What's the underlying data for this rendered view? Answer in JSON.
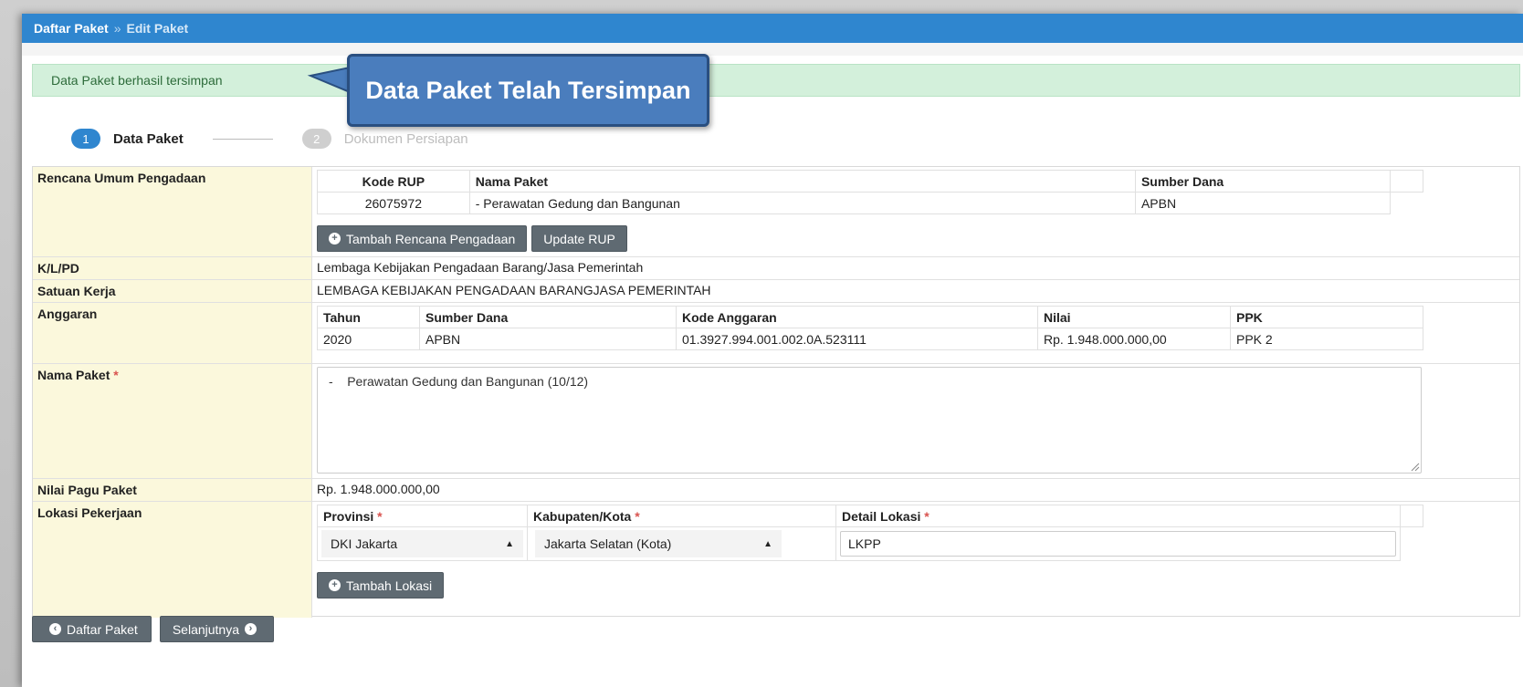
{
  "breadcrumb": {
    "root": "Daftar Paket",
    "sep": "»",
    "current": "Edit Paket"
  },
  "alert": {
    "message": "Data Paket berhasil tersimpan"
  },
  "callout": {
    "text": "Data Paket Telah Tersimpan"
  },
  "steps": [
    {
      "num": "1",
      "label": "Data Paket",
      "active": true
    },
    {
      "num": "2",
      "label": "Dokumen Persiapan",
      "active": false
    }
  ],
  "rup": {
    "label": "Rencana Umum Pengadaan",
    "headers": [
      "Kode RUP",
      "Nama Paket",
      "Sumber Dana"
    ],
    "rows": [
      [
        "26075972",
        "- Perawatan Gedung dan Bangunan",
        "APBN"
      ]
    ],
    "btn_add": "Tambah Rencana Pengadaan",
    "btn_update": "Update RUP"
  },
  "klpd": {
    "label": "K/L/PD",
    "value": "Lembaga Kebijakan Pengadaan Barang/Jasa Pemerintah"
  },
  "satker": {
    "label": "Satuan Kerja",
    "value": "LEMBAGA KEBIJAKAN PENGADAAN BARANGJASA PEMERINTAH"
  },
  "anggaran": {
    "label": "Anggaran",
    "headers": [
      "Tahun",
      "Sumber Dana",
      "Kode Anggaran",
      "Nilai",
      "PPK"
    ],
    "rows": [
      [
        "2020",
        "APBN",
        "01.3927.994.001.002.0A.523111",
        "Rp. 1.948.000.000,00",
        "PPK 2"
      ]
    ]
  },
  "nama_paket": {
    "label": "Nama Paket",
    "required": "*",
    "value": "-    Perawatan Gedung dan Bangunan (10/12)"
  },
  "pagu": {
    "label": "Nilai Pagu Paket",
    "value": "Rp. 1.948.000.000,00"
  },
  "lokasi": {
    "label": "Lokasi Pekerjaan",
    "col_provinsi": "Provinsi",
    "col_kabupaten": "Kabupaten/Kota",
    "col_detail": "Detail Lokasi",
    "required": "*",
    "provinsi": "DKI Jakarta",
    "kabupaten": "Jakarta Selatan (Kota)",
    "detail": "LKPP",
    "btn_add": "Tambah Lokasi"
  },
  "footer": {
    "btn_back": "Daftar Paket",
    "btn_next": "Selanjutnya"
  }
}
